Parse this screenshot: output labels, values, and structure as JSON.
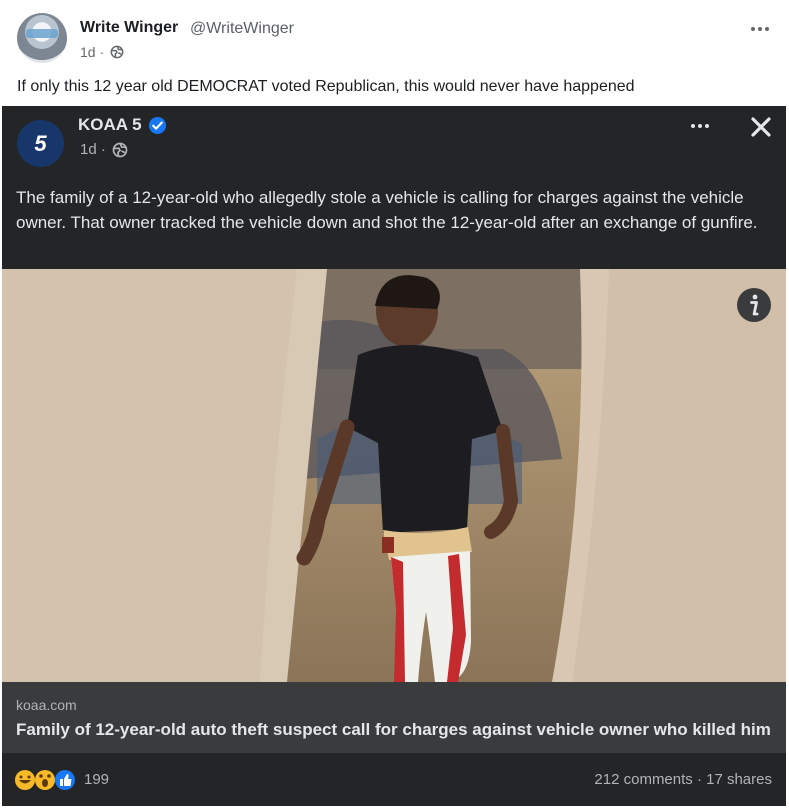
{
  "post": {
    "author_name": "Write Winger",
    "author_handle": "@WriteWinger",
    "time": "1d ·",
    "text": "If only this 12 year old DEMOCRAT voted Republican, this would never have happened"
  },
  "embedded": {
    "page_name": "KOAA 5",
    "time": "1d ·",
    "logo_text": "5",
    "text": "The family of a 12-year-old who allegedly stole a vehicle is calling for charges against the vehicle owner. That owner tracked the vehicle down and shot the 12-year-old after an exchange of gunfire.",
    "link_domain": "koaa.com",
    "link_title": "Family of 12-year-old auto theft suspect call for charges against vehicle owner who killed him",
    "reaction_count": "199",
    "engagement": "212 comments · 17 shares"
  },
  "icons": {
    "globe": "globe-icon",
    "menu": "more-options-icon",
    "verified": "verified-badge-icon",
    "close": "close-icon",
    "info": "info-icon"
  },
  "colors": {
    "verified_blue": "#1877f2",
    "dark_background": "#242526",
    "link_card": "#3a3b3c"
  }
}
